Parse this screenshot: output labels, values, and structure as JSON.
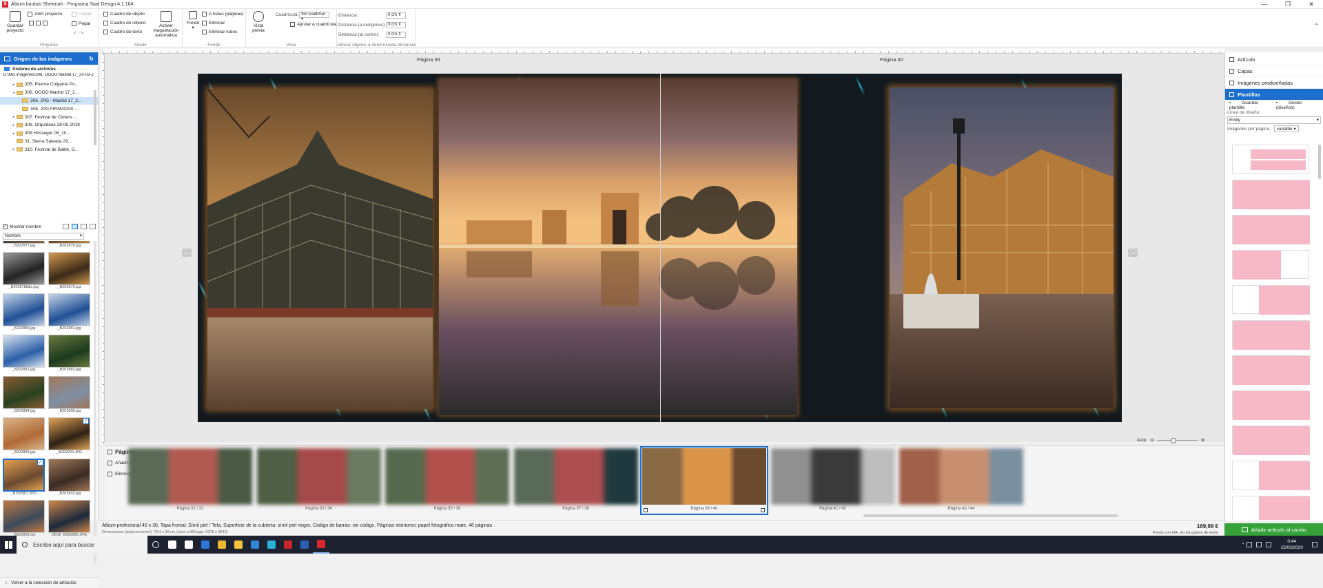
{
  "window": {
    "title": "Álbum bautizo Shekinah - Programa Saal Design 4.1.164",
    "controls": [
      "—",
      "❐",
      "✕"
    ]
  },
  "ribbon": {
    "proyecto": {
      "group": "Proyecto",
      "save": "Guardar proyecto",
      "open": "Abrir proyecto",
      "copy": "Copiar",
      "paste": "Pegar"
    },
    "anadir": {
      "group": "Añadir",
      "object_box": "Cuadro de objeto",
      "fill_box": "Cuadro de relleno",
      "text_box": "Cuadro de texto",
      "auto_layout": "Activar maquetación automática"
    },
    "fondo": {
      "group": "Fondo",
      "fondo": "Fondo",
      "all_pages": "A todas (páginas)",
      "delete": "Eliminar",
      "delete_all": "Eliminar todos"
    },
    "vista": {
      "group": "Vista",
      "preview": "Vista previa",
      "grid_label": "Cuadrícula:",
      "grid_value": "Sin cuadrícul",
      "snap": "Ajustar a cuadrícula"
    },
    "align": {
      "group": "Alinear objetos a determinada distancia",
      "distance": "Distancia:",
      "distance_val": "0 cm",
      "dist_margins": "Distancia (a márgenes):",
      "dist_margins_val": "0 cm",
      "dist_center": "Distancia (al centro):",
      "dist_center_val": "0 cm"
    }
  },
  "left": {
    "header": "Origen de las imágenes",
    "system": "Sistema de archivos",
    "path": "D:\\Mis imágenes\\306. OOOO Madrid 17_20-03-2",
    "tree": [
      {
        "label": "305. Puente Colgante Po...",
        "indent": 2,
        "tw": "▸",
        "sel": false
      },
      {
        "label": "306. OOOO Madrid 17_2...",
        "indent": 2,
        "tw": "◂",
        "sel": false
      },
      {
        "label": "306. JPG - Madrid 17_2...",
        "indent": 3,
        "tw": "",
        "sel": true
      },
      {
        "label": "306. JPG FIRMADAS -...",
        "indent": 3,
        "tw": "",
        "sel": false
      },
      {
        "label": "307. Festival de Clowns ...",
        "indent": 2,
        "tw": "▸",
        "sel": false
      },
      {
        "label": "308. Orquídeas 28-05-2018",
        "indent": 2,
        "tw": "▸",
        "sel": false
      },
      {
        "label": "309 Hossegor 08_10...",
        "indent": 2,
        "tw": "▸",
        "sel": false
      },
      {
        "label": "31. Sierra Salvada 29...",
        "indent": 2,
        "tw": "",
        "sel": false
      },
      {
        "label": "310. Festival de Ballet, G...",
        "indent": 2,
        "tw": "▸",
        "sel": false
      }
    ],
    "show_name": "Mostrar nombre",
    "sort": "Nombre",
    "thumbs": [
      {
        "label": "_B202877.jpg",
        "c1": "#3b3b3b",
        "c2": "#8b6a45",
        "sel": false,
        "check": false
      },
      {
        "label": "_B202878.jpg",
        "c1": "#5a3a22",
        "c2": "#c08a45",
        "sel": false,
        "check": false
      },
      {
        "label": "_B202878b&n.jpg",
        "c1": "#222",
        "c2": "#9a9a9a",
        "sel": false,
        "check": false
      },
      {
        "label": "_B202879.jpg",
        "c1": "#3b2a18",
        "c2": "#d29a50",
        "sel": false,
        "check": false
      },
      {
        "label": "_B202880.jpg",
        "c1": "#1f4f95",
        "c2": "#c5d6e8",
        "sel": false,
        "check": false
      },
      {
        "label": "_B202881.jpg",
        "c1": "#1f4f95",
        "c2": "#c5d6e8",
        "sel": false,
        "check": false
      },
      {
        "label": "_B202882.jpg",
        "c1": "#2a5fa8",
        "c2": "#d9e3ee",
        "sel": false,
        "check": false
      },
      {
        "label": "_B202883.jpg",
        "c1": "#1d3a1e",
        "c2": "#6a7a40",
        "sel": false,
        "check": false
      },
      {
        "label": "_B202884.jpg",
        "c1": "#27421f",
        "c2": "#8a5a35",
        "sel": false,
        "check": false
      },
      {
        "label": "_B202898.jpg",
        "c1": "#7e8fa4",
        "c2": "#a1785a",
        "sel": false,
        "check": false
      },
      {
        "label": "_B202899.jpg",
        "c1": "#b06a35",
        "c2": "#d9b48a",
        "sel": false,
        "check": false
      },
      {
        "label": "_B202900.JPG",
        "c1": "#2d2014",
        "c2": "#e2a55a",
        "sel": false,
        "check": true
      },
      {
        "label": "_B202901.JPG",
        "c1": "#6a4a30",
        "c2": "#e5a050",
        "sel": true,
        "check": true
      },
      {
        "label": "_B202902.jpg",
        "c1": "#3a2a22",
        "c2": "#a07a5a",
        "sel": false,
        "check": false
      },
      {
        "label": "_B202903.jpg",
        "c1": "#3b4a5a",
        "c2": "#c07a45",
        "sel": false,
        "check": false
      },
      {
        "label": "DB10_B202906.JPG",
        "c1": "#1c2a3b",
        "c2": "#d0884a",
        "sel": false,
        "check": false
      }
    ],
    "back": "Volver a la selección de artículos"
  },
  "canvas": {
    "left_page": "Página 39",
    "right_page": "Página 40"
  },
  "zoom": {
    "label": "Auto"
  },
  "pages": {
    "title": "Páginas",
    "add": "Añadir página",
    "delete": "Eliminar página",
    "items": [
      {
        "label": "Página 31 / 32",
        "c1": "#5a6a55",
        "c2": "#b05a50",
        "c3": "#4a5a45",
        "sel": false,
        "sharp": false
      },
      {
        "label": "Página 33 / 34",
        "c1": "#4e5f45",
        "c2": "#a54a48",
        "c3": "#6a7a60",
        "sel": false,
        "sharp": false
      },
      {
        "label": "Página 35 / 36",
        "c1": "#556a4e",
        "c2": "#b2504c",
        "c3": "#5e6e55",
        "sel": false,
        "sharp": false
      },
      {
        "label": "Página 37 / 38",
        "c1": "#5a6a5a",
        "c2": "#ae4e4e",
        "c3": "#20393f",
        "sel": false,
        "sharp": false
      },
      {
        "label": "Página 39 / 40",
        "c1": "#8a6a45",
        "c2": "#d9944a",
        "c3": "#6b4a2e",
        "sel": true,
        "sharp": true
      },
      {
        "label": "Página 41 / 42",
        "c1": "#909090",
        "c2": "#3a3a3a",
        "c3": "#bdbdbd",
        "sel": false,
        "sharp": false
      },
      {
        "label": "Página 43 / 44",
        "c1": "#a0604a",
        "c2": "#c99070",
        "c3": "#7a8fa0",
        "sel": false,
        "sharp": false
      }
    ]
  },
  "right": {
    "items": [
      "Artículo",
      "Capas",
      "Imágenes prediseñadas",
      "Plantillas"
    ],
    "active": 3,
    "save_template": "Guardar plantilla",
    "manager": "Gestor (diseños)",
    "design_line_label": "Línea de diseño:",
    "design_line": "Emily",
    "ipp_label": "Imágenes por página:",
    "ipp_value": "variable"
  },
  "status": {
    "line1": "Álbum profesional 40 x 30, Tapa frontal: Símil piel / Tela, Superficie de la cubierta: símil piel negro, Código de barras: sin código, Páginas interiores: papel fotográfico mate, 46 páginas",
    "line2": "Dimensiones (página interior): 79,4 x 30 cm (píxel a 300 ppp: 9378 x 3543)",
    "price": "169,99 €",
    "price_note": "Precio con IVA, sin los gastos de envío",
    "add_to_cart": "Añadir artículo al carrito"
  },
  "taskbar": {
    "search": "Escribe aquí para buscar",
    "time": "0:44",
    "date": "15/03/2020",
    "icons": [
      {
        "name": "task-view-icon",
        "color": "#ffffff"
      },
      {
        "name": "store-icon",
        "color": "#ffffff"
      },
      {
        "name": "edge-icon",
        "color": "#2a78d6"
      },
      {
        "name": "chrome-icon",
        "color": "#e9b930"
      },
      {
        "name": "explorer-icon",
        "color": "#f3c340"
      },
      {
        "name": "photos-icon",
        "color": "#2f86d6"
      },
      {
        "name": "app-icon",
        "color": "#2bb0d9"
      },
      {
        "name": "mcafee-icon",
        "color": "#c8262b"
      },
      {
        "name": "word-icon",
        "color": "#2b5fb3"
      },
      {
        "name": "saal-icon",
        "color": "#d9272e"
      }
    ]
  }
}
